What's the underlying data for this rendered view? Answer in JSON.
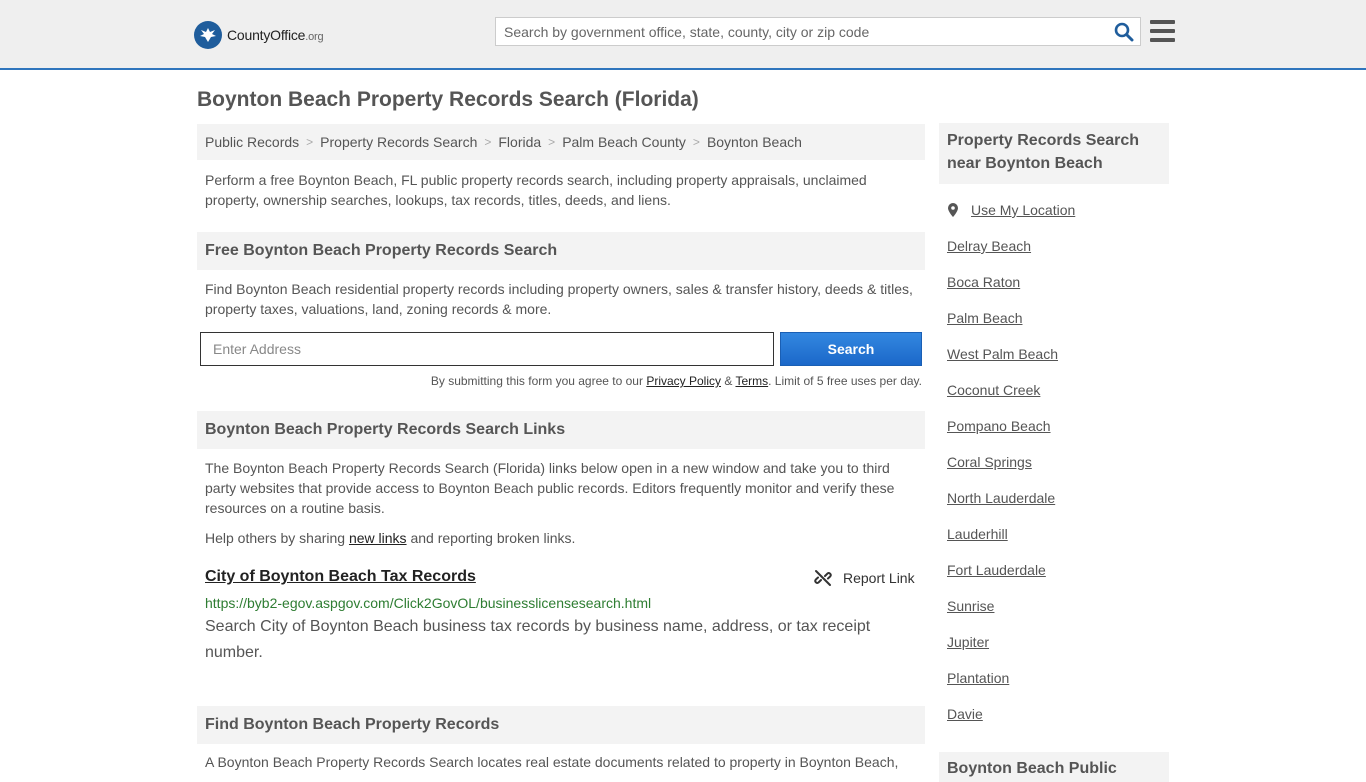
{
  "header": {
    "logo_name": "CountyOffice",
    "logo_tld": ".org",
    "search_placeholder": "Search by government office, state, county, city or zip code"
  },
  "page_title": "Boynton Beach Property Records Search (Florida)",
  "breadcrumb": [
    "Public Records",
    "Property Records Search",
    "Florida",
    "Palm Beach County",
    "Boynton Beach"
  ],
  "intro": "Perform a free Boynton Beach, FL public property records search, including property appraisals, unclaimed property, ownership searches, lookups, tax records, titles, deeds, and liens.",
  "free_search": {
    "heading": "Free Boynton Beach Property Records Search",
    "description": "Find Boynton Beach residential property records including property owners, sales & transfer history, deeds & titles, property taxes, valuations, land, zoning records & more.",
    "address_placeholder": "Enter Address",
    "button_label": "Search",
    "terms_prefix": "By submitting this form you agree to our ",
    "privacy_label": "Privacy Policy",
    "terms_amp": " & ",
    "terms_label": "Terms",
    "terms_suffix": ". Limit of 5 free uses per day."
  },
  "links_section": {
    "heading": "Boynton Beach Property Records Search Links",
    "description": "The Boynton Beach Property Records Search (Florida) links below open in a new window and take you to third party websites that provide access to Boynton Beach public records. Editors frequently monitor and verify these resources on a routine basis.",
    "help_prefix": "Help others by sharing ",
    "help_link": "new links",
    "help_suffix": " and reporting broken links."
  },
  "record": {
    "title": "City of Boynton Beach Tax Records",
    "report_label": "Report Link",
    "url": "https://byb2-egov.aspgov.com/Click2GovOL/businesslicensesearch.html",
    "description": "Search City of Boynton Beach business tax records by business name, address, or tax receipt number."
  },
  "find_section": {
    "heading": "Find Boynton Beach Property Records",
    "description": "A Boynton Beach Property Records Search locates real estate documents related to property in Boynton Beach,"
  },
  "sidebar": {
    "heading": "Property Records Search near Boynton Beach",
    "use_location": "Use My Location",
    "cities": [
      "Delray Beach",
      "Boca Raton",
      "Palm Beach",
      "West Palm Beach",
      "Coconut Creek",
      "Pompano Beach",
      "Coral Springs",
      "North Lauderdale",
      "Lauderhill",
      "Fort Lauderdale",
      "Sunrise",
      "Jupiter",
      "Plantation",
      "Davie"
    ],
    "next_heading": "Boynton Beach Public"
  }
}
